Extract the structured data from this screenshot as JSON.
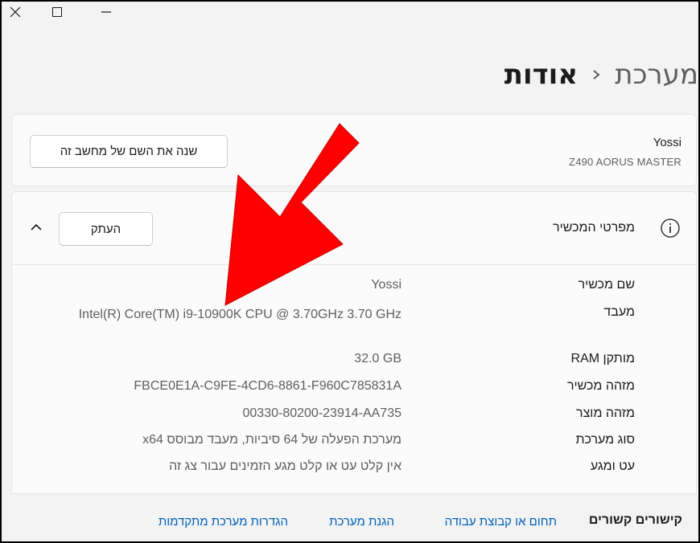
{
  "window": {
    "close_icon": "close-icon",
    "maximize_icon": "maximize-icon",
    "minimize_icon": "minimize-icon"
  },
  "breadcrumb": {
    "parent": "מערכת",
    "separator_icon": "chevron-right-icon",
    "current": "אודות"
  },
  "device": {
    "name": "Yossi",
    "model": "Z490 AORUS MASTER",
    "rename_label": "שנה את השם של מחשב זה"
  },
  "specs": {
    "title": "מפרטי המכשיר",
    "info_icon": "info-icon",
    "copy_label": "העתק",
    "collapse_icon": "chevron-up-icon",
    "rows": [
      {
        "label": "שם מכשיר",
        "value": "Yossi"
      },
      {
        "label": "מעבד",
        "value": "Intel(R) Core(TM) i9-10900K CPU @ 3.70GHz   3.70 GHz"
      },
      {
        "label": "מותקן RAM",
        "value": "32.0 GB"
      },
      {
        "label": "מזהה מכשיר",
        "value": "FBCE0E1A-C9FE-4CD6-8861-F960C785831A"
      },
      {
        "label": "מזהה מוצר",
        "value": "00330-80200-23914-AA735"
      },
      {
        "label": "סוג מערכת",
        "value": "מערכת הפעלה של 64 סיביות, מעבד מבוסס x64"
      },
      {
        "label": "עט ומגע",
        "value": "אין קלט עט או קלט מגע הזמינים עבור צג זה"
      }
    ]
  },
  "related": {
    "title": "קישורים קשורים",
    "links": [
      "תחום או קבוצת עבודה",
      "הגנת מערכת",
      "הגדרות מערכת מתקדמות"
    ]
  },
  "colors": {
    "accent_link": "#005fb8",
    "annotation_arrow": "#ff0000"
  }
}
